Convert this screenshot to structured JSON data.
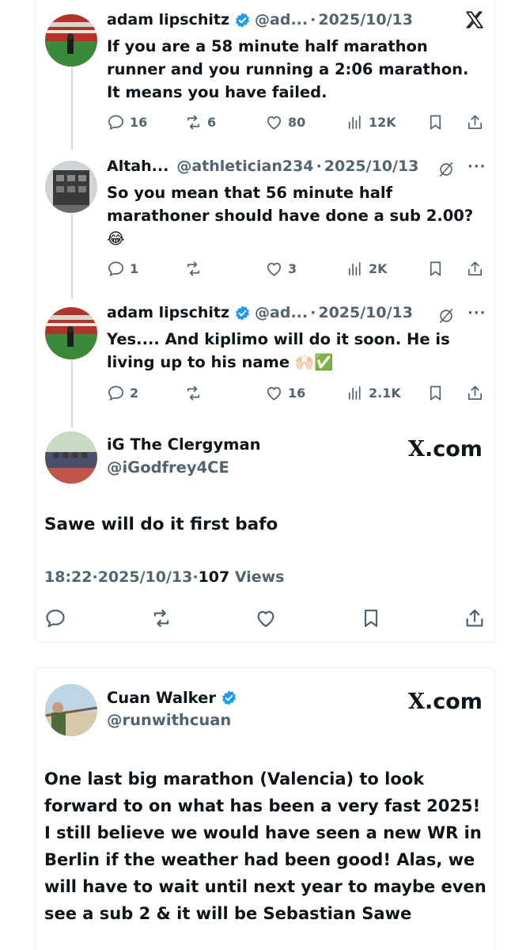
{
  "tweets": [
    {
      "name": "adam lipschitz",
      "handle": "@ad...",
      "date": "2025/10/13",
      "text": "If you are a 58 minute half marathon runner and you running a 2:06 marathon. It means you have failed.",
      "replies": "16",
      "reposts": "6",
      "likes": "80",
      "views": "12K"
    },
    {
      "name": "Altah...",
      "handle": "@athletician234",
      "date": "2025/10/13",
      "text": "So you mean that 56 minute half marathoner should have done a sub 2.00? 😂",
      "replies": "1",
      "reposts": "",
      "likes": "3",
      "views": "2K"
    },
    {
      "name": "adam lipschitz",
      "handle": "@ad...",
      "date": "2025/10/13",
      "text": "Yes.... And kiplimo will do it soon. He is living up to his name 🙌🏻✅",
      "replies": "2",
      "reposts": "",
      "likes": "16",
      "views": "2.1K"
    }
  ],
  "reply": {
    "name": "iG The Clergyman",
    "handle": "@iGodfrey4CE",
    "site": ".com",
    "site_x": "X",
    "text": "Sawe will do it first bafo",
    "time": "18:22",
    "date": "2025/10/13",
    "views_count": "107",
    "views_label": "Views"
  },
  "second_post": {
    "name": "Cuan Walker",
    "handle": "@runwithcuan",
    "site": ".com",
    "site_x": "X",
    "text": "One last big marathon (Valencia) to look forward to on what has been a very fast 2025! I still believe we would have seen a new WR in Berlin if the weather had been good! Alas, we will have to wait until next year to maybe even see a sub 2 & it will be Sebastian Sawe"
  },
  "separator": "·",
  "more": "···",
  "colors": {
    "text": "#0f1419",
    "muted": "#536471",
    "verified": "#1d9bf0",
    "border": "#eceff1"
  }
}
